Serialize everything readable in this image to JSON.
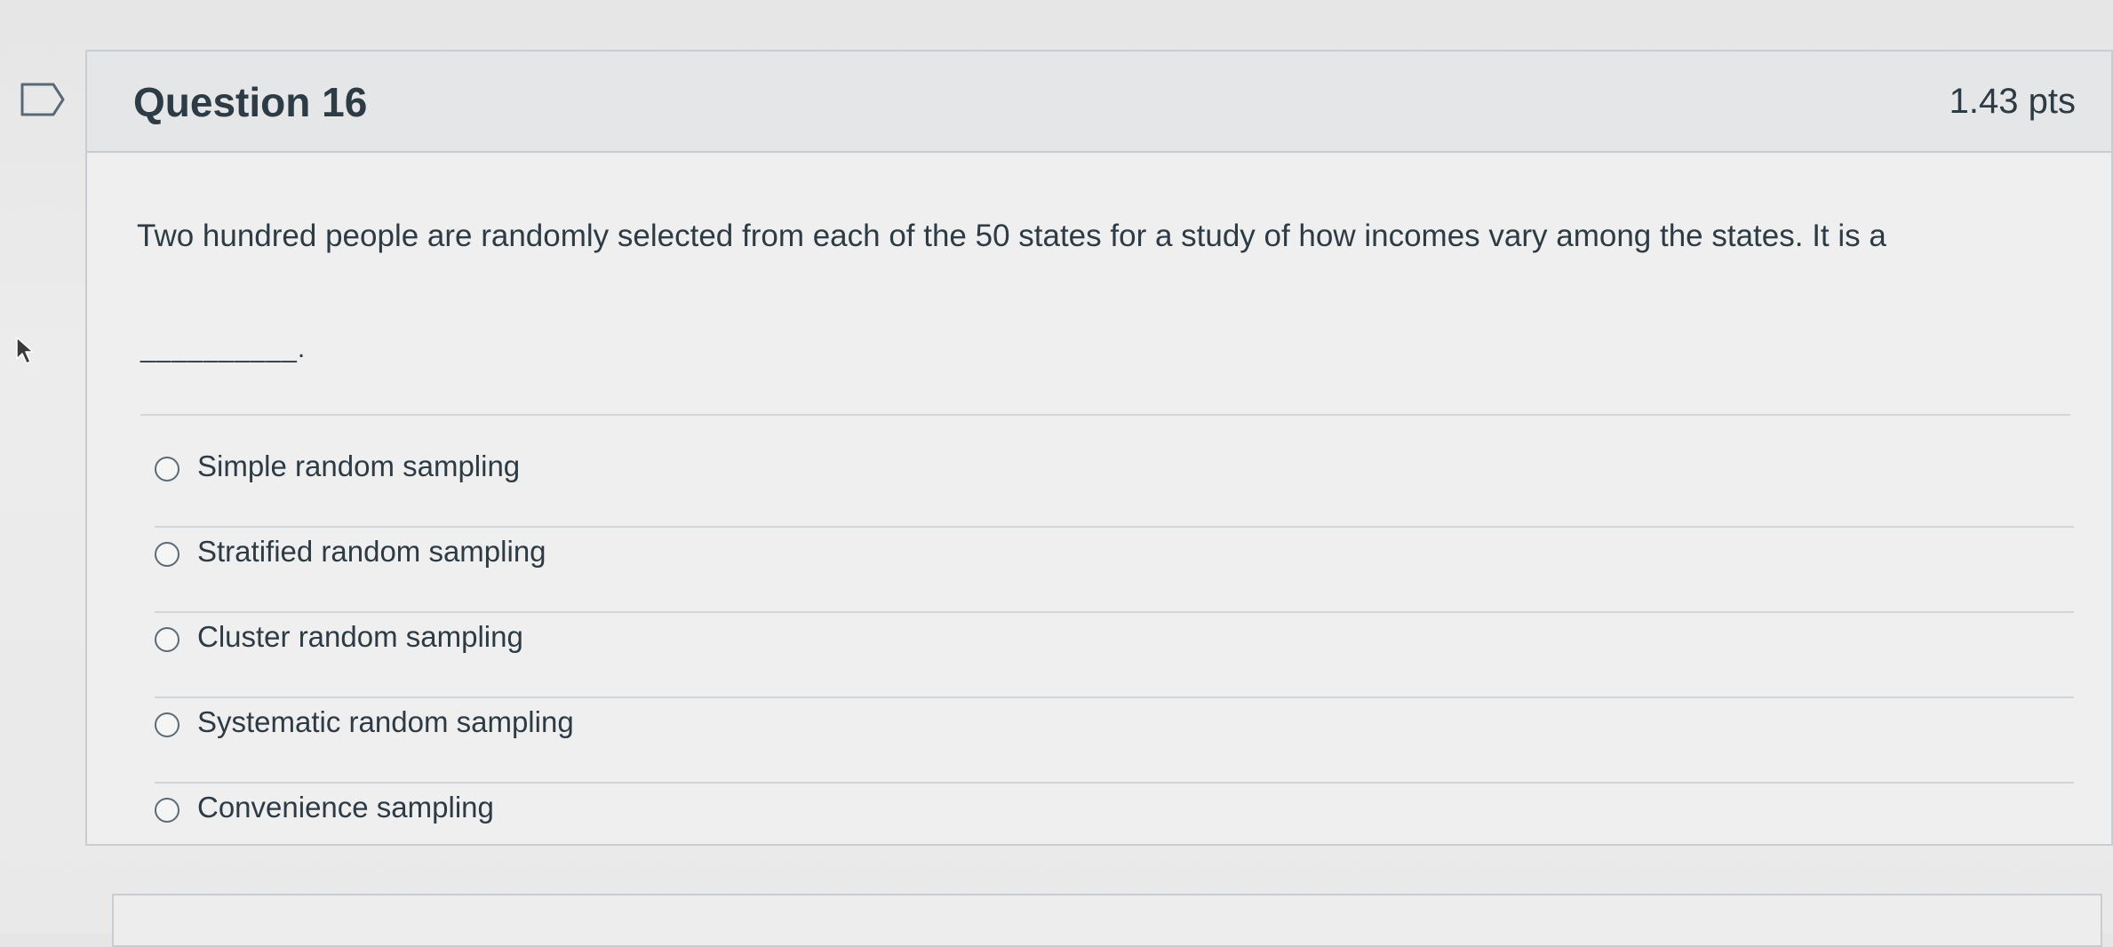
{
  "question": {
    "title": "Question 16",
    "points": "1.43 pts",
    "text": "Two hundred people are randomly selected from each of the 50 states for a study of how incomes vary among the states. It is a",
    "blank": "__________."
  },
  "answers": [
    {
      "label": "Simple random sampling"
    },
    {
      "label": "Stratified random sampling"
    },
    {
      "label": "Cluster random sampling"
    },
    {
      "label": "Systematic random sampling"
    },
    {
      "label": "Convenience sampling"
    }
  ],
  "icons": {
    "flag": "bookmark-flag-icon",
    "cursor": "mouse-pointer-icon"
  }
}
